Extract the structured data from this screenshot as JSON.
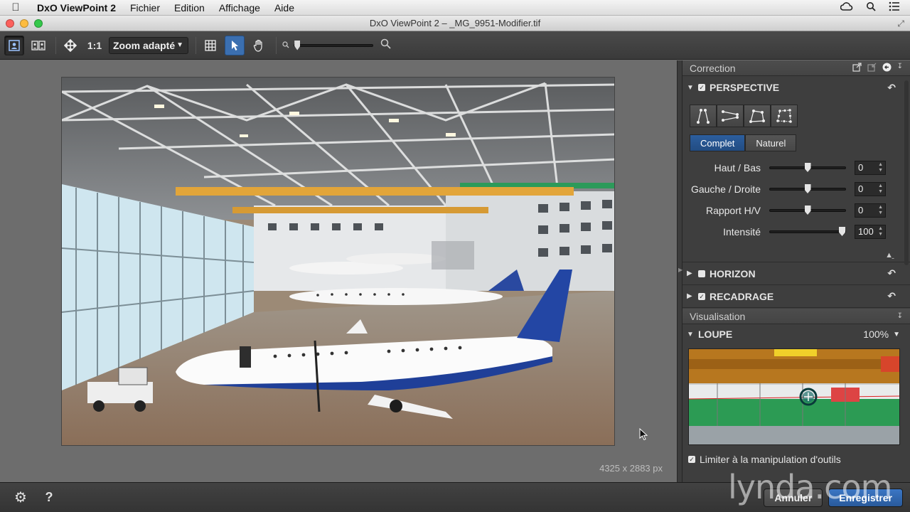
{
  "menubar": {
    "app": "DxO ViewPoint 2",
    "items": [
      "Fichier",
      "Edition",
      "Affichage",
      "Aide"
    ]
  },
  "window": {
    "title": "DxO ViewPoint 2 – _MG_9951-Modifier.tif"
  },
  "toolbar": {
    "one_to_one": "1:1",
    "zoom_select": "Zoom adapté",
    "zoom_level": 0.02
  },
  "canvas": {
    "dimensions": "4325 x 2883 px"
  },
  "panel": {
    "correction_title": "Correction",
    "perspective": {
      "label": "PERSPECTIVE",
      "checked": true,
      "modes": [
        "Complet",
        "Naturel"
      ],
      "selected_mode": "Complet",
      "sliders": [
        {
          "label": "Haut / Bas",
          "value": "0",
          "level": 0.5
        },
        {
          "label": "Gauche / Droite",
          "value": "0",
          "level": 0.5
        },
        {
          "label": "Rapport H/V",
          "value": "0",
          "level": 0.5
        },
        {
          "label": "Intensité",
          "value": "100",
          "level": 1.0
        }
      ]
    },
    "horizon": {
      "label": "HORIZON",
      "checked": false
    },
    "recadrage": {
      "label": "RECADRAGE",
      "checked": true
    },
    "visualisation_title": "Visualisation",
    "loupe": {
      "label": "LOUPE",
      "zoom": "100%"
    },
    "limit_label": "Limiter à la manipulation d'outils"
  },
  "bottom": {
    "cancel": "Annuler",
    "save": "Enregistrer"
  },
  "watermark": "lynda.com",
  "colors": {
    "accent": "#3b6fb0",
    "panel_bg": "#3e3e3e",
    "toolbar_bg": "#3f3f3f"
  }
}
